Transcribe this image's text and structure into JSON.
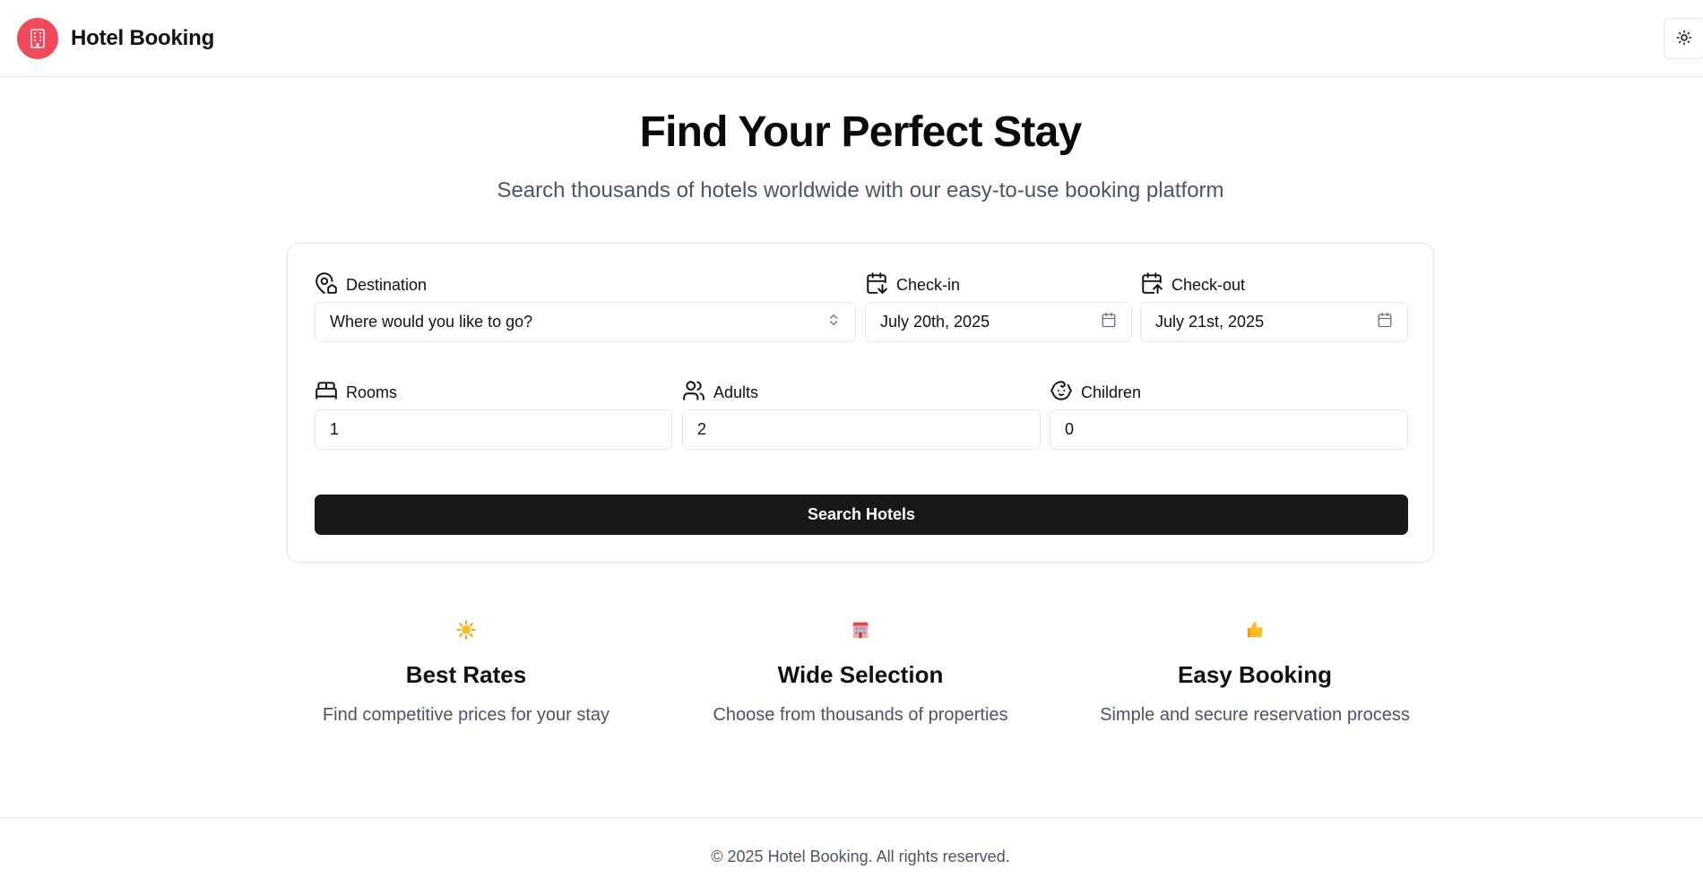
{
  "header": {
    "brand_name": "Hotel Booking",
    "logo_icon": "hotel-building-icon",
    "theme_toggle_icon": "sun-icon",
    "accent_color": "#f14a5a"
  },
  "hero": {
    "title": "Find Your Perfect Stay",
    "subtitle": "Search thousands of hotels worldwide with our easy-to-use booking platform"
  },
  "search": {
    "destination": {
      "label": "Destination",
      "icon": "map-pin-house-icon",
      "value": "Where would you like to go?"
    },
    "checkin": {
      "label": "Check-in",
      "icon": "calendar-arrow-down-icon",
      "value": "July 20th, 2025"
    },
    "checkout": {
      "label": "Check-out",
      "icon": "calendar-arrow-up-icon",
      "value": "July 21st, 2025"
    },
    "rooms": {
      "label": "Rooms",
      "icon": "bed-icon",
      "value": "1"
    },
    "adults": {
      "label": "Adults",
      "icon": "users-icon",
      "value": "2"
    },
    "children": {
      "label": "Children",
      "icon": "baby-icon",
      "value": "0"
    },
    "submit_label": "Search Hotels",
    "button_color": "#18181b"
  },
  "features": [
    {
      "icon": "sun-emoji-icon",
      "title": "Best Rates",
      "description": "Find competitive prices for your stay"
    },
    {
      "icon": "hotel-emoji-icon",
      "title": "Wide Selection",
      "description": "Choose from thousands of properties"
    },
    {
      "icon": "thumbs-up-emoji-icon",
      "title": "Easy Booking",
      "description": "Simple and secure reservation process"
    }
  ],
  "footer": {
    "copyright": "© 2025 Hotel Booking. All rights reserved."
  }
}
